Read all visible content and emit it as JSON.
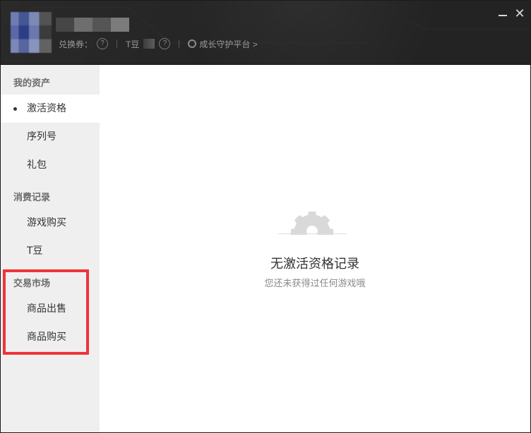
{
  "header": {
    "coupon_label": "兑换券：",
    "help_icon": "question-circle-icon",
    "tdou_label": "T豆",
    "guard_icon": "chat-bubble-icon",
    "guard_link": "成长守护平台 >",
    "minimize_icon": "minimize-icon",
    "close_icon": "close-icon",
    "close_glyph": "✕"
  },
  "sidebar": {
    "sections": [
      {
        "title": "我的资产",
        "items": [
          "激活资格",
          "序列号",
          "礼包"
        ]
      },
      {
        "title": "消费记录",
        "items": [
          "游戏购买",
          "T豆"
        ]
      },
      {
        "title": "交易市场",
        "items": [
          "商品出售",
          "商品购买"
        ]
      }
    ],
    "active_item": "激活资格"
  },
  "main": {
    "empty_icon": "gear-icon",
    "empty_title": "无激活资格记录",
    "empty_subtitle": "您还未获得过任何游戏哦"
  },
  "colors": {
    "header_bg": "#232323",
    "sidebar_bg": "#efefef",
    "highlight_border": "#f0333a",
    "gear_icon": "#d9d9d9"
  }
}
